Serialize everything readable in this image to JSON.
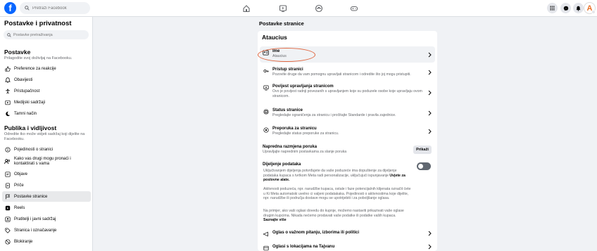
{
  "topbar": {
    "logo": "f",
    "search_placeholder": "Pretraži Facebook",
    "avatar_letter": "A"
  },
  "sidebar": {
    "title": "Postavke i privatnost",
    "search_placeholder": "Postavke pretraživanja",
    "section1": {
      "title": "Postavke",
      "desc": "Prilagodite svoj doživljaj na Facebooku."
    },
    "items1": [
      {
        "label": "Preference za reakcije",
        "icon": "reaction-icon"
      },
      {
        "label": "Obavijesti",
        "icon": "bell-icon"
      },
      {
        "label": "Pristupačnost",
        "icon": "accessibility-icon"
      },
      {
        "label": "Medijski sadržaji",
        "icon": "media-icon"
      },
      {
        "label": "Tamni način",
        "icon": "moon-icon"
      }
    ],
    "section2": {
      "title": "Publika i vidljivost",
      "desc": "Odredite tko može vidjeti sadržaj koji dijelite na Facebooku."
    },
    "items2": [
      {
        "label": "Pojedinosti o stranici",
        "icon": "info-icon"
      },
      {
        "label": "Kako vas drugi mogu pronaći i kontaktirati s vama",
        "icon": "people-icon"
      },
      {
        "label": "Objave",
        "icon": "post-icon"
      },
      {
        "label": "Priče",
        "icon": "stories-icon"
      },
      {
        "label": "Postavke stranice",
        "icon": "page-icon"
      },
      {
        "label": "Reels",
        "icon": "reels-icon"
      },
      {
        "label": "Pratitelji i javni sadržaj",
        "icon": "followers-icon"
      },
      {
        "label": "Stranica i označavanje",
        "icon": "tag-icon"
      },
      {
        "label": "Blokiranje",
        "icon": "block-icon"
      }
    ]
  },
  "main": {
    "title": "Postavke stranice",
    "card_title": "Ataucius",
    "rows": [
      {
        "title": "Ime",
        "sub": "Ataucius"
      },
      {
        "title": "Pristup stranici",
        "sub": "Pozovite druge da vam pomognu upravljati stranicom i odredite što joj mogu pristupiti."
      },
      {
        "title": "Povijest upravljanja stranicom",
        "sub": "Ovo je povijest radnji povezanih s upravljanjem koje su poduzele osobe koje upravljaju ovom stranicom."
      },
      {
        "title": "Status stranice",
        "sub": "Pregledajte ograničenja za stranicu i pročitajte Standarde i pravila zajednice."
      },
      {
        "title": "Preporuka za stranicu",
        "sub": "Pregledajte status preporuke za stranicu."
      }
    ],
    "messaging": {
      "title": "Napredna razmjena poruka",
      "sub": "Upravljajte naprednim postavkama za slanje poruka",
      "button": "Prikaži"
    },
    "data_sharing": {
      "title": "Dijeljenje podataka",
      "p1": "Uključivanjem dijeljenja potvrđujete da vaše poduzeće ima dopuštenje za dijeljenje podataka kupaca s tvrtkom Meta radi personalizacije, uključujući ispunjavanje",
      "p1_link": "Uvjete za poslovne alate.",
      "p2": "Aktivnosti poduzeća, npr. narudžbe kupaca, ostale i faze potencijalnih klijenata označit ćete u Ki Meta automatski uvelno ci valjeni podatakaka. Pojedinosti o aktivnostima koje dijelite, npr. narudžbe ili područja dostave mogu se upotrijebiti i za poboljšanje oglasa.",
      "p3": "Na primjer, ako vaši oglasi dovedu do kupnje, možemo nastaviti prikazivati vaše oglase drugim kupcima. Nikada nećemo prodavati vaše podatke ili podatke vaših kupaca.",
      "p3_link": "Saznajte više"
    },
    "rows_bottom": [
      {
        "title": "Oglas o važnom pitanju, izborima ili politici"
      },
      {
        "title": "Oglasi s lokacijama na Tajvanu"
      }
    ]
  }
}
